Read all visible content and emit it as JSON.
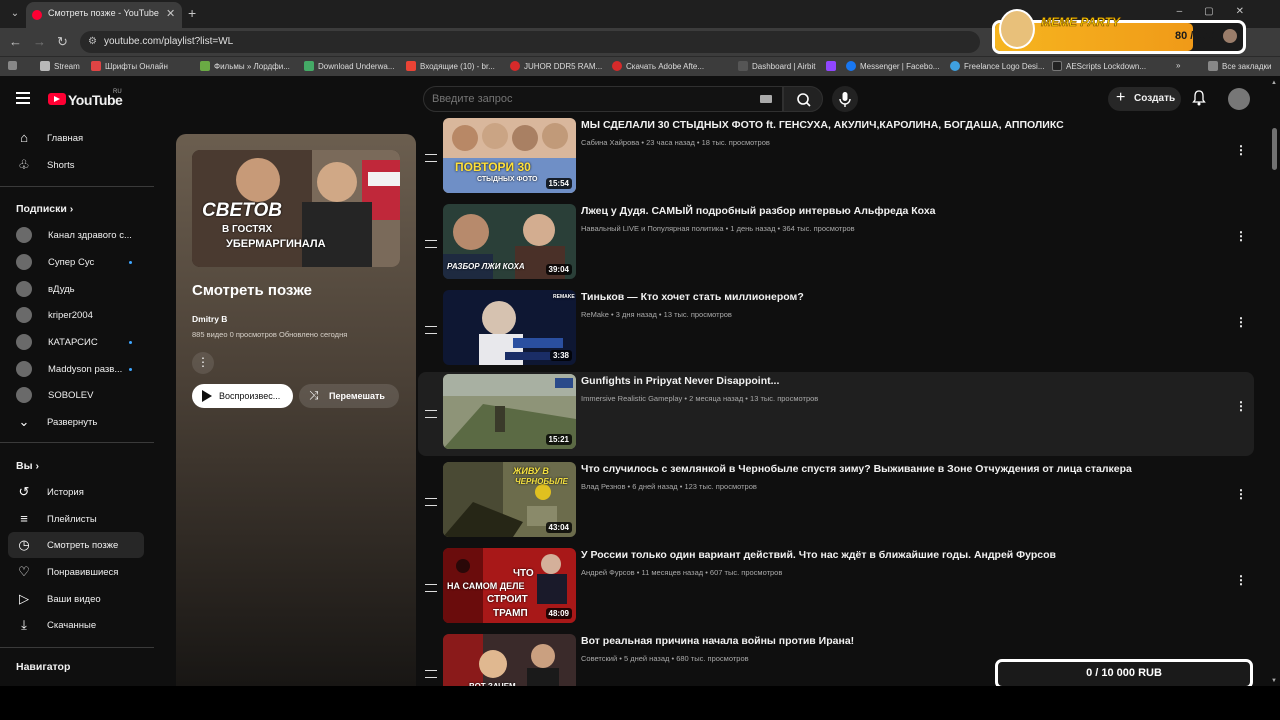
{
  "browser": {
    "tab_title": "Смотреть позже - YouTube",
    "url": "youtube.com/playlist?list=WL",
    "bookmarks": [
      "Stream",
      "Шрифты Онлайн",
      "Фильмы » Лордфи...",
      "Download Underwa...",
      "Входящие (10) - br...",
      "JUHOR DDR5 RAM...",
      "Скачать Adobe Afte...",
      "Dashboard | Airbit",
      "Messenger | Facebo...",
      "Freelance Logo Desi...",
      "AEScripts Lockdown..."
    ],
    "all_bookmarks": "Все закладки"
  },
  "meme_widget": {
    "title": "MEME PARTY",
    "count": "80 / 100",
    "progress": 0.8
  },
  "rub_widget": {
    "label": "0 / 10 000 RUB"
  },
  "header": {
    "logo": "YouTube",
    "logo_region": "RU",
    "search_placeholder": "Введите запрос",
    "create_label": "Создать"
  },
  "sidebar": {
    "main": [
      {
        "label": "Главная",
        "icon": "home-icon"
      },
      {
        "label": "Shorts",
        "icon": "shorts-icon"
      }
    ],
    "subs_heading": "Подписки",
    "subs": [
      {
        "label": "Канал здравого с...",
        "dot": false
      },
      {
        "label": "Супер Сус",
        "dot": true
      },
      {
        "label": "вДудь",
        "dot": false
      },
      {
        "label": "kriper2004",
        "dot": false
      },
      {
        "label": "КАТАРСИС",
        "dot": true
      },
      {
        "label": "Maddyson разв...",
        "dot": true
      },
      {
        "label": "SOBOLEV",
        "dot": false
      }
    ],
    "expand_label": "Развернуть",
    "you_heading": "Вы",
    "you": [
      {
        "label": "История",
        "icon": "history-icon"
      },
      {
        "label": "Плейлисты",
        "icon": "playlists-icon"
      },
      {
        "label": "Смотреть позже",
        "icon": "watch-later-icon",
        "active": true
      },
      {
        "label": "Понравившиеся",
        "icon": "like-icon"
      },
      {
        "label": "Ваши видео",
        "icon": "your-videos-icon"
      },
      {
        "label": "Скачанные",
        "icon": "download-icon"
      }
    ],
    "nav_heading": "Навигатор"
  },
  "playlist": {
    "thumb_caption_1": "СВЕТОВ",
    "thumb_caption_2": "В ГОСТЯХ",
    "thumb_caption_3": "УБЕРМАРГИНАЛА",
    "title": "Смотреть позже",
    "owner": "Dmitry B",
    "stats": "885 видео   0 просмотров   Обновлено сегодня",
    "play_label": "Воспроизвес...",
    "shuffle_label": "Перемешать"
  },
  "videos": [
    {
      "title": "МЫ СДЕЛАЛИ 30 СТЫДНЫХ ФОТО ft. ГЕНСУХА, АКУЛИЧ,КАРОЛИНА, БОГДАША, АППОЛИКС",
      "meta": "Сабина Хайрова • 23 часа назад • 18 тыс. просмотров",
      "duration": "15:54",
      "caption": "ПОВТОРИ 30",
      "caption2": "СТЫДНЫХ ФОТО",
      "c1": "#c89a7e",
      "c2": "#6a8fc0"
    },
    {
      "title": "Лжец у Дудя. САМЫЙ подробный разбор интервью Альфреда Коха",
      "meta": "Навальный LIVE и Популярная политика • 1 день назад • 364 тыс. просмотров",
      "duration": "39:04",
      "caption": "РАЗБОР ЛЖИ КОХА",
      "caption2": "",
      "c1": "#2d4a3e",
      "c2": "#8a6a54"
    },
    {
      "title": "Тиньков — Кто хочет стать миллионером?",
      "meta": "ReMake • 3 дня назад • 13 тыс. просмотров",
      "duration": "3:38",
      "caption": "REMAKE",
      "caption2": "",
      "c1": "#101a3a",
      "c2": "#3a4a7a"
    },
    {
      "title": "Gunfights in Pripyat Never Disappoint...",
      "meta": "Immersive Realistic Gameplay • 2 месяца назад • 13 тыс. просмотров",
      "duration": "15:21",
      "caption": "",
      "caption2": "",
      "c1": "#5a6a4a",
      "c2": "#9aa088",
      "highlight": true
    },
    {
      "title": "Что случилось с землянкой в Чернобыле спустя зиму? Выживание в Зоне Отчуждения от лица сталкера",
      "meta": "Влад Резнов • 6 дней назад • 123 тыс. просмотров",
      "duration": "43:04",
      "caption": "ЖИВУ В",
      "caption2": "ЧЕРНОБЫЛЕ",
      "c1": "#6a6a4a",
      "c2": "#3a3a2a"
    },
    {
      "title": "У России только один вариант действий. Что нас ждёт в ближайшие годы. Андрей Фурсов",
      "meta": "Андрей Фурсов • 11 месяцев назад • 607 тыс. просмотров",
      "duration": "48:09",
      "caption": "ЧТО",
      "caption2": "НА САМОМ ДЕЛЕ",
      "caption3": "СТРОИТ",
      "caption4": "ТРАМП",
      "c1": "#9a1414",
      "c2": "#5a0a0a"
    },
    {
      "title": "Вот реальная причина начала войны против Ирана!",
      "meta": "Советский • 5 дней назад • 680 тыс. просмотров",
      "duration": "",
      "caption": "ВОТ ЗАЧЕМ",
      "caption2": "",
      "c1": "#7a2020",
      "c2": "#2a2a3a"
    }
  ]
}
